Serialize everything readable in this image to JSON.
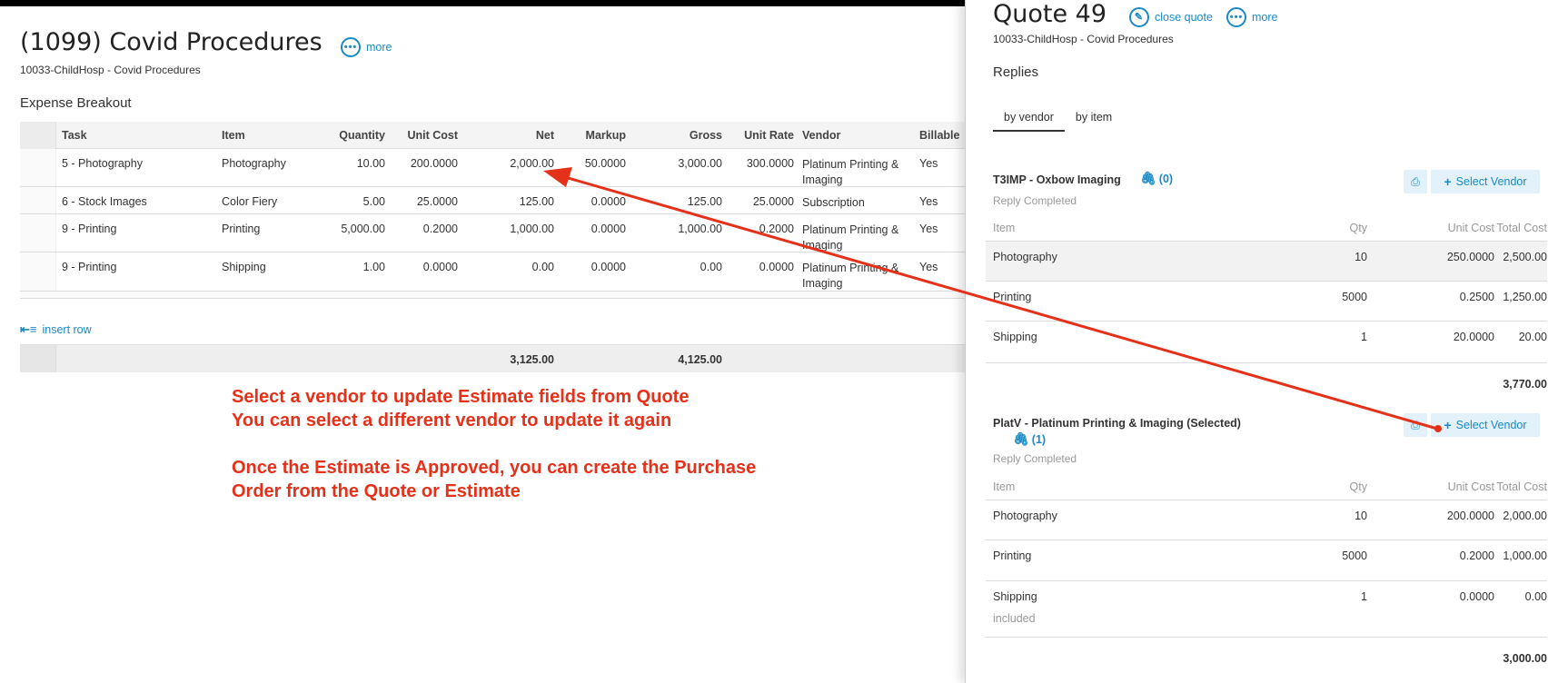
{
  "job": {
    "title": "(1099) Covid Procedures",
    "more_label": "more",
    "subtitle": "10033-ChildHosp - Covid Procedures"
  },
  "expense": {
    "section_title": "Expense Breakout",
    "columns": [
      "Task",
      "Item",
      "Quantity",
      "Unit Cost",
      "Net",
      "Markup",
      "Gross",
      "Unit Rate",
      "Vendor",
      "Billable"
    ],
    "rows": [
      {
        "task": "5 - Photography",
        "item": "Photography",
        "quantity": "10.00",
        "unit_cost": "200.0000",
        "net": "2,000.00",
        "markup": "50.0000",
        "gross": "3,000.00",
        "unit_rate": "300.0000",
        "vendor": "Platinum Printing & Imaging",
        "billable": "Yes"
      },
      {
        "task": "6 - Stock Images",
        "item": "Color Fiery",
        "quantity": "5.00",
        "unit_cost": "25.0000",
        "net": "125.00",
        "markup": "0.0000",
        "gross": "125.00",
        "unit_rate": "25.0000",
        "vendor": "Subscription",
        "billable": "Yes"
      },
      {
        "task": "9 - Printing",
        "item": "Printing",
        "quantity": "5,000.00",
        "unit_cost": "0.2000",
        "net": "1,000.00",
        "markup": "0.0000",
        "gross": "1,000.00",
        "unit_rate": "0.2000",
        "vendor": "Platinum Printing & Imaging",
        "billable": "Yes"
      },
      {
        "task": "9 - Printing",
        "item": "Shipping",
        "quantity": "1.00",
        "unit_cost": "0.0000",
        "net": "0.00",
        "markup": "0.0000",
        "gross": "0.00",
        "unit_rate": "0.0000",
        "vendor": "Platinum Printing & Imaging",
        "billable": "Yes"
      }
    ],
    "insert_row_label": "insert row",
    "total_net": "3,125.00",
    "total_gross": "4,125.00"
  },
  "annotation": {
    "line1": "Select a vendor to update Estimate fields from Quote",
    "line2": "You can select a different vendor to update it again",
    "line3": "Once the Estimate is Approved, you can create the Purchase",
    "line4": "Order from the Quote or Estimate",
    "color": "#e5311a"
  },
  "quote": {
    "title": "Quote 49",
    "close_label": "close quote",
    "more_label": "more",
    "subtitle": "10033-ChildHosp - Covid Procedures",
    "replies_label": "Replies",
    "tabs": [
      "by vendor",
      "by item"
    ],
    "columns": [
      "Item",
      "Qty",
      "Unit Cost",
      "Total Cost"
    ],
    "select_vendor_label": "Select Vendor",
    "vendors": [
      {
        "name": "T3IMP - Oxbow Imaging",
        "attachments": "(0)",
        "status": "Reply Completed",
        "rows": [
          {
            "item": "Photography",
            "qty": "10",
            "unit_cost": "250.0000",
            "total_cost": "2,500.00"
          },
          {
            "item": "Printing",
            "qty": "5000",
            "unit_cost": "0.2500",
            "total_cost": "1,250.00"
          },
          {
            "item": "Shipping",
            "qty": "1",
            "unit_cost": "20.0000",
            "total_cost": "20.00"
          }
        ],
        "total": "3,770.00"
      },
      {
        "name": "PlatV - Platinum Printing & Imaging (Selected)",
        "attachments": "(1)",
        "status": "Reply Completed",
        "rows": [
          {
            "item": "Photography",
            "qty": "10",
            "unit_cost": "200.0000",
            "total_cost": "2,000.00"
          },
          {
            "item": "Printing",
            "qty": "5000",
            "unit_cost": "0.2000",
            "total_cost": "1,000.00"
          },
          {
            "item": "Shipping",
            "qty": "1",
            "unit_cost": "0.0000",
            "total_cost": "0.00",
            "note": "included"
          }
        ],
        "total": "3,000.00"
      }
    ]
  },
  "colors": {
    "accent": "#1a8ac6",
    "accent_bg": "#e2f1fa",
    "arrow": "#e5311a"
  }
}
